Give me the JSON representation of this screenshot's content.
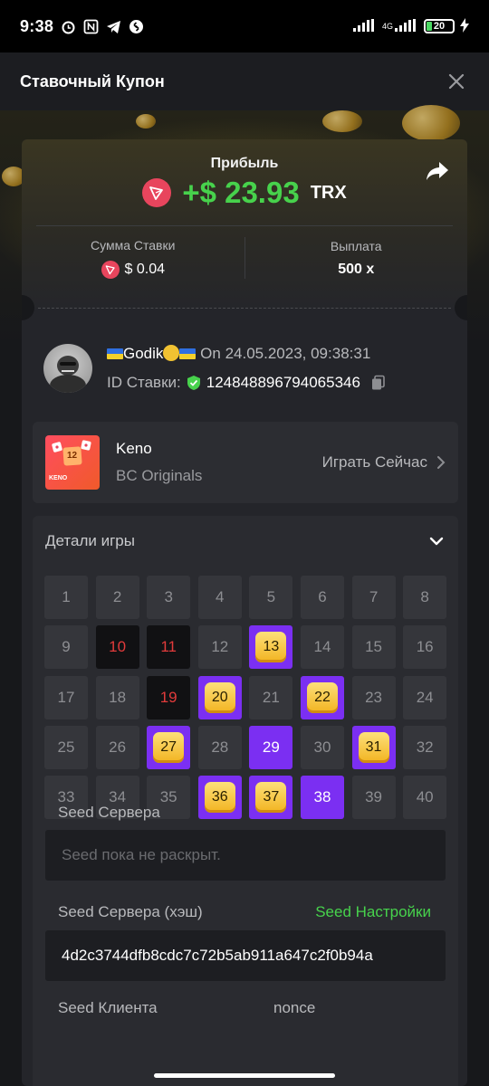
{
  "status_bar": {
    "time": "9:38",
    "network": "4G",
    "battery": "20",
    "icons_left": [
      "alarm-icon",
      "nfc-icon",
      "telegram-icon",
      "shazam-icon"
    ]
  },
  "header": {
    "title": "Ставочный Купон"
  },
  "profit": {
    "label": "Прибыль",
    "amount": "+$ 23.93",
    "currency": "TRX"
  },
  "stats": {
    "bet_label": "Сумма Ставки",
    "bet_value": "$ 0.04",
    "payout_label": "Выплата",
    "payout_value": "500 x"
  },
  "user": {
    "name": "Godik",
    "date_prefix": "On",
    "date": "24.05.2023, 09:38:31",
    "bet_id_label": "ID Ставки:",
    "bet_id": "124848896794065346"
  },
  "game": {
    "name": "Keno",
    "provider": "BC Originals",
    "thumb_number": "12",
    "thumb_label": "KENO",
    "play_label": "Играть Сейчас"
  },
  "details": {
    "title": "Детали игры",
    "cells": [
      {
        "n": "1",
        "s": "n"
      },
      {
        "n": "2",
        "s": "n"
      },
      {
        "n": "3",
        "s": "n"
      },
      {
        "n": "4",
        "s": "n"
      },
      {
        "n": "5",
        "s": "n"
      },
      {
        "n": "6",
        "s": "n"
      },
      {
        "n": "7",
        "s": "n"
      },
      {
        "n": "8",
        "s": "n"
      },
      {
        "n": "9",
        "s": "n"
      },
      {
        "n": "10",
        "s": "miss"
      },
      {
        "n": "11",
        "s": "miss"
      },
      {
        "n": "12",
        "s": "n"
      },
      {
        "n": "13",
        "s": "hit"
      },
      {
        "n": "14",
        "s": "n"
      },
      {
        "n": "15",
        "s": "n"
      },
      {
        "n": "16",
        "s": "n"
      },
      {
        "n": "17",
        "s": "n"
      },
      {
        "n": "18",
        "s": "n"
      },
      {
        "n": "19",
        "s": "miss"
      },
      {
        "n": "20",
        "s": "hit"
      },
      {
        "n": "21",
        "s": "n"
      },
      {
        "n": "22",
        "s": "hit"
      },
      {
        "n": "23",
        "s": "n"
      },
      {
        "n": "24",
        "s": "n"
      },
      {
        "n": "25",
        "s": "n"
      },
      {
        "n": "26",
        "s": "n"
      },
      {
        "n": "27",
        "s": "hit"
      },
      {
        "n": "28",
        "s": "n"
      },
      {
        "n": "29",
        "s": "pick"
      },
      {
        "n": "30",
        "s": "n"
      },
      {
        "n": "31",
        "s": "hit"
      },
      {
        "n": "32",
        "s": "n"
      },
      {
        "n": "33",
        "s": "n"
      },
      {
        "n": "34",
        "s": "n"
      },
      {
        "n": "35",
        "s": "n"
      },
      {
        "n": "36",
        "s": "hit"
      },
      {
        "n": "37",
        "s": "hit"
      },
      {
        "n": "38",
        "s": "pick"
      },
      {
        "n": "39",
        "s": "n"
      },
      {
        "n": "40",
        "s": "n"
      }
    ],
    "server_seed_label": "Seed Сервера",
    "server_seed_placeholder": "Seed пока не раскрыт.",
    "server_hash_label": "Seed Сервера (хэш)",
    "seed_settings_label": "Seed Настройки",
    "server_hash_value": "4d2c3744dfb8cdc7c72b5ab911a647c2f0b94a",
    "client_seed_label": "Seed Клиента",
    "nonce_label": "nonce"
  },
  "colors": {
    "profit_green": "#47d24c",
    "keno_purple": "#7b2ff2",
    "trx_red": "#e8455d",
    "miss_red": "#e23b3b"
  }
}
